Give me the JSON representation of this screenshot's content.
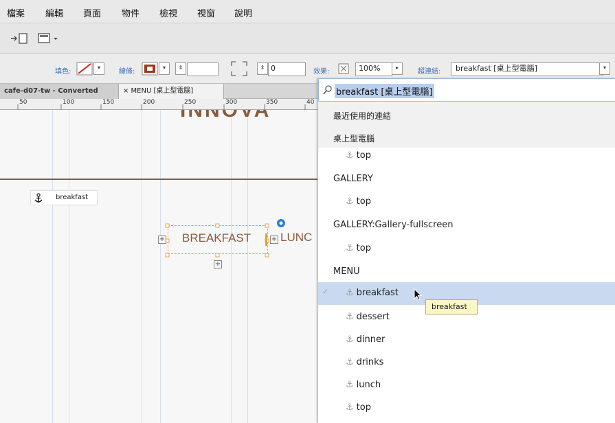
{
  "menubar": {
    "items": [
      "檔案",
      "編輯",
      "頁面",
      "物件",
      "檢視",
      "視窗",
      "說明"
    ]
  },
  "toolbar2": {
    "fill_label": "填色:",
    "stroke_label": "線條:",
    "corner_value": "0",
    "effects_label": "效果:",
    "opacity_value": "100%",
    "link_label": "超連結:",
    "link_value": "breakfast [桌上型電腦]"
  },
  "tabs": [
    {
      "label": "cafe-d07-tw - Converted"
    },
    {
      "label": "× MENU [桌上型電腦]"
    }
  ],
  "ruler": {
    "ticks": [
      "50",
      "100",
      "150",
      "200",
      "250",
      "300",
      "350",
      "40"
    ]
  },
  "canvas": {
    "heading_fragment": "INNOVA",
    "anchor_label": "breakfast",
    "breakfast_text": "BREAKFAST",
    "lunch_text": "LUNC"
  },
  "colors": {
    "brown": "#8a5a3a",
    "selection_orange": "#e8a33c",
    "accent_blue": "#2f7ad6",
    "highlight_row": "#c9d9ef"
  },
  "panel": {
    "search_value": "breakfast [桌上型電腦]",
    "recent_header": "最近使用的連結",
    "groups": [
      {
        "name": "桌上型電腦",
        "items": [
          "top"
        ]
      },
      {
        "name": "GALLERY",
        "items": [
          "top"
        ]
      },
      {
        "name": "GALLERY:Gallery-fullscreen",
        "items": [
          "top"
        ]
      },
      {
        "name": "MENU",
        "items": [
          "breakfast",
          "dessert",
          "dinner",
          "drinks",
          "lunch",
          "top"
        ]
      }
    ],
    "selected_item": "breakfast",
    "tooltip": "breakfast"
  }
}
